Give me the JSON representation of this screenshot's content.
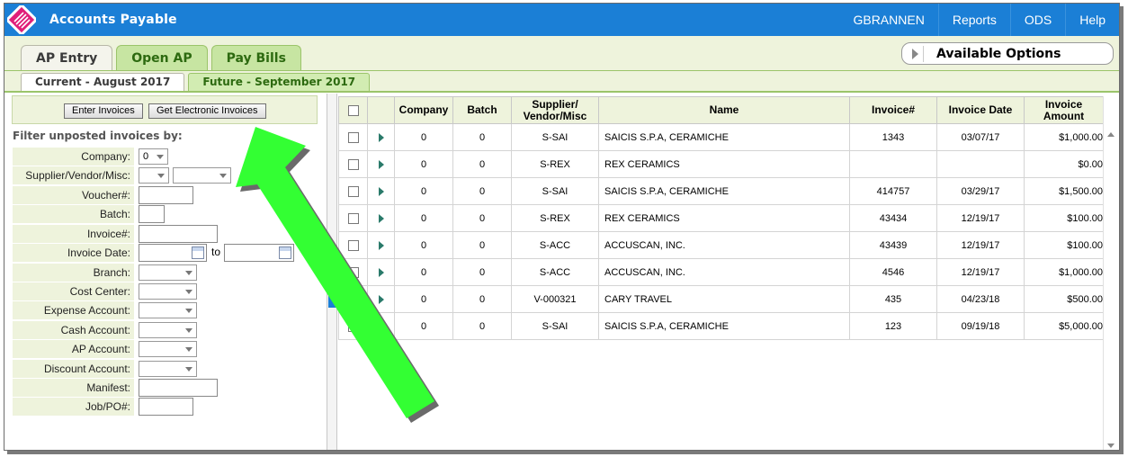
{
  "app": {
    "title": "Accounts Payable",
    "logo_icon": "striped-logo-icon"
  },
  "topnav": [
    {
      "label": "GBRANNEN"
    },
    {
      "label": "Reports"
    },
    {
      "label": "ODS"
    },
    {
      "label": "Help"
    }
  ],
  "tabs": {
    "main": [
      "AP Entry",
      "Open AP",
      "Pay Bills"
    ],
    "active_main": "AP Entry",
    "sub": [
      "Current - August 2017",
      "Future - September 2017"
    ],
    "active_sub": "Current - August 2017"
  },
  "available_options": "Available Options",
  "buttons": {
    "enter_invoices": "Enter Invoices",
    "get_electronic": "Get Electronic Invoices"
  },
  "filter": {
    "title": "Filter unposted invoices by:",
    "labels": {
      "company": "Company:",
      "supplier": "Supplier/Vendor/Misc:",
      "voucher": "Voucher#:",
      "batch": "Batch:",
      "invoice": "Invoice#:",
      "invoice_date": "Invoice Date:",
      "branch": "Branch:",
      "cost_center": "Cost Center:",
      "expense": "Expense Account:",
      "cash": "Cash Account:",
      "ap": "AP Account:",
      "discount": "Discount Account:",
      "manifest": "Manifest:",
      "job": "Job/PO#:"
    },
    "company_value": "0",
    "to_label": "to"
  },
  "grid": {
    "headers": {
      "company": "Company",
      "batch": "Batch",
      "supplier_1": "Supplier/",
      "supplier_2": "Vendor/Misc",
      "name": "Name",
      "invoice": "Invoice#",
      "invoice_date": "Invoice Date",
      "amount_1": "Invoice",
      "amount_2": "Amount"
    },
    "rows": [
      {
        "company": "0",
        "batch": "0",
        "supplier": "S-SAI",
        "name": "SAICIS S.P.A, CERAMICHE",
        "invoice": "1343",
        "date": "03/07/17",
        "amount": "$1,000.00"
      },
      {
        "company": "0",
        "batch": "0",
        "supplier": "S-REX",
        "name": "REX CERAMICS",
        "invoice": "",
        "date": "",
        "amount": "$0.00"
      },
      {
        "company": "0",
        "batch": "0",
        "supplier": "S-SAI",
        "name": "SAICIS S.P.A, CERAMICHE",
        "invoice": "414757",
        "date": "03/29/17",
        "amount": "$1,500.00"
      },
      {
        "company": "0",
        "batch": "0",
        "supplier": "S-REX",
        "name": "REX CERAMICS",
        "invoice": "43434",
        "date": "12/19/17",
        "amount": "$100.00"
      },
      {
        "company": "0",
        "batch": "0",
        "supplier": "S-ACC",
        "name": "ACCUSCAN, INC.",
        "invoice": "43439",
        "date": "12/19/17",
        "amount": "$100.00"
      },
      {
        "company": "0",
        "batch": "0",
        "supplier": "S-ACC",
        "name": "ACCUSCAN, INC.",
        "invoice": "4546",
        "date": "12/19/17",
        "amount": "$1,000.00"
      },
      {
        "company": "0",
        "batch": "0",
        "supplier": "V-000321",
        "name": "CARY TRAVEL",
        "invoice": "435",
        "date": "04/23/18",
        "amount": "$500.00"
      },
      {
        "company": "0",
        "batch": "0",
        "supplier": "S-SAI",
        "name": "SAICIS S.P.A, CERAMICHE",
        "invoice": "123",
        "date": "09/19/18",
        "amount": "$5,000.00"
      }
    ]
  },
  "colors": {
    "topbar": "#1b7fd6",
    "tab_green": "#c7e5a2",
    "panel_bg": "#eef3dc",
    "arrow": "#33ff33"
  }
}
